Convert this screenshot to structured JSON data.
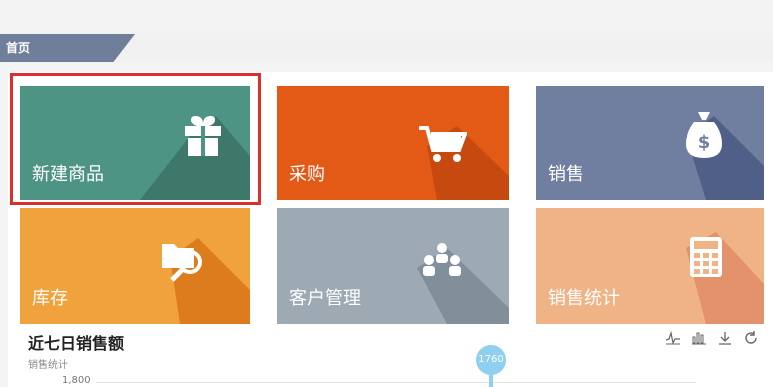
{
  "breadcrumb": {
    "label": "首页"
  },
  "tiles": [
    {
      "label": "新建商品",
      "color": "#4e9485",
      "icon": "gift-icon"
    },
    {
      "label": "采购",
      "color": "#e35a17",
      "icon": "cart-icon"
    },
    {
      "label": "销售",
      "color": "#707fa0",
      "icon": "money-bag-icon"
    },
    {
      "label": "库存",
      "color": "#f0a33c",
      "icon": "folder-search-icon"
    },
    {
      "label": "客户管理",
      "color": "#9eaab3",
      "icon": "users-icon"
    },
    {
      "label": "销售统计",
      "color": "#efb386",
      "icon": "calculator-icon"
    }
  ],
  "chart": {
    "title": "近七日销售额",
    "legend_label": "销售统计",
    "y_tick": "1,800",
    "tooltip_value": "1760"
  },
  "colors": {
    "accent_border": "#d92f2f",
    "breadcrumb_bg": "#6f7f9b"
  }
}
